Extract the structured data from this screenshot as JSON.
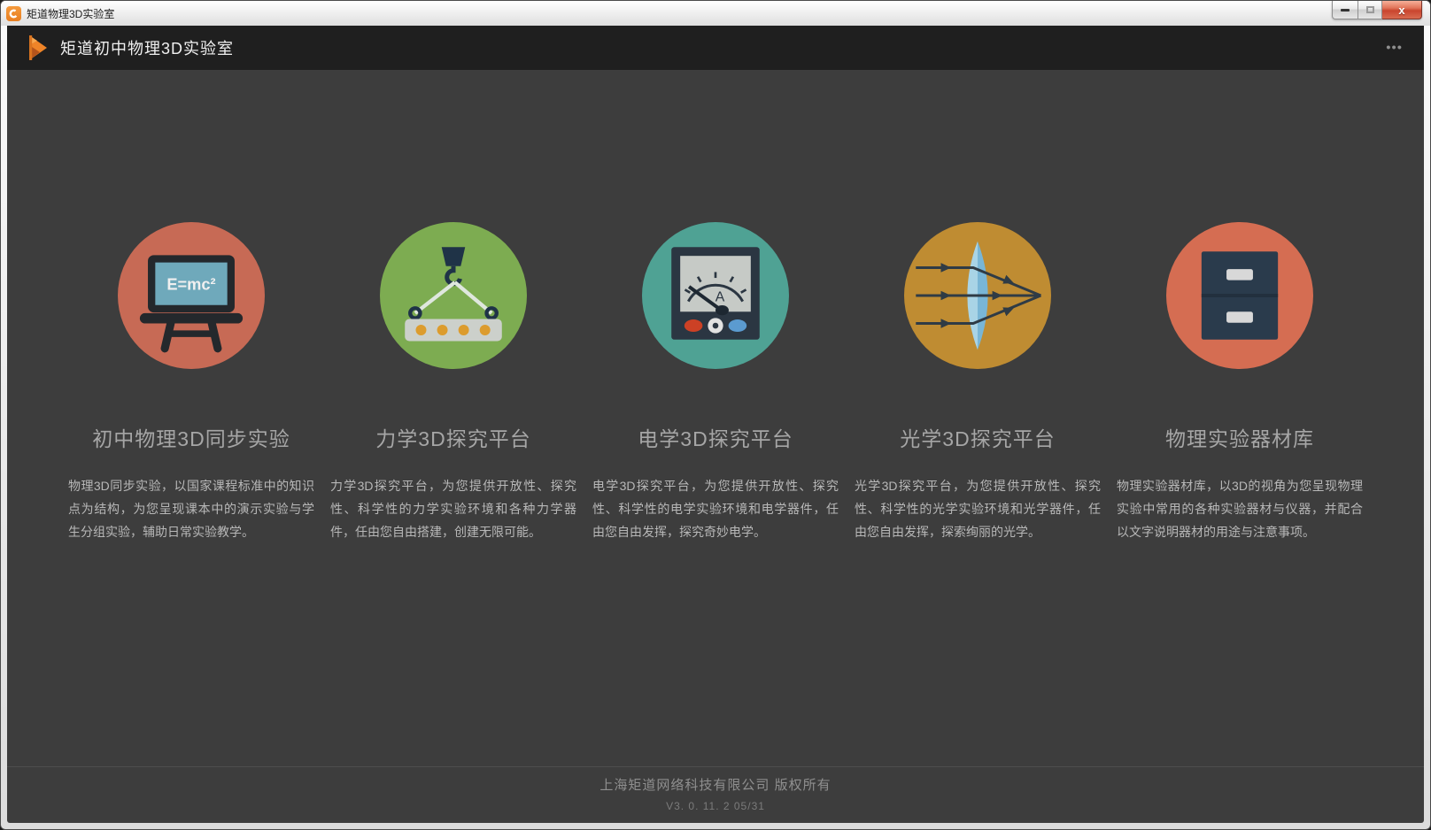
{
  "window": {
    "title": "矩道物理3D实验室",
    "controls": {
      "close_glyph": "x"
    }
  },
  "header": {
    "title": "矩道初中物理3D实验室",
    "menu_dots": "•••"
  },
  "colors": {
    "sync_circle": "#c76a55",
    "mechanics_circle": "#7dac51",
    "electricity_circle": "#4fa294",
    "optics_circle": "#bf8c32",
    "equipment_circle": "#d56d52"
  },
  "modules": [
    {
      "title": "初中物理3D同步实验",
      "description": "物理3D同步实验，以国家课程标准中的知识点为结构，为您呈现课本中的演示实验与学生分组实验，辅助日常实验教学。",
      "icon": "blackboard-icon",
      "board_formula": "E=mc²"
    },
    {
      "title": "力学3D探究平台",
      "description": "力学3D探究平台，为您提供开放性、探究性、科学性的力学实验环境和各种力学器件，任由您自由搭建，创建无限可能。",
      "icon": "crane-hook-icon"
    },
    {
      "title": "电学3D探究平台",
      "description": "电学3D探究平台，为您提供开放性、探究性、科学性的电学实验环境和电学器件，任由您自由发挥，探究奇妙电学。",
      "icon": "ammeter-icon",
      "meter_label": "A"
    },
    {
      "title": "光学3D探究平台",
      "description": "光学3D探究平台，为您提供开放性、探究性、科学性的光学实验环境和光学器件，任由您自由发挥，探索绚丽的光学。",
      "icon": "convex-lens-icon"
    },
    {
      "title": "物理实验器材库",
      "description": "物理实验器材库，以3D的视角为您呈现物理实验中常用的各种实验器材与仪器，并配合以文字说明器材的用途与注意事项。",
      "icon": "cabinet-icon"
    }
  ],
  "footer": {
    "copyright": "上海矩道网络科技有限公司  版权所有",
    "version": "V3. 0. 11. 2  05/31"
  }
}
